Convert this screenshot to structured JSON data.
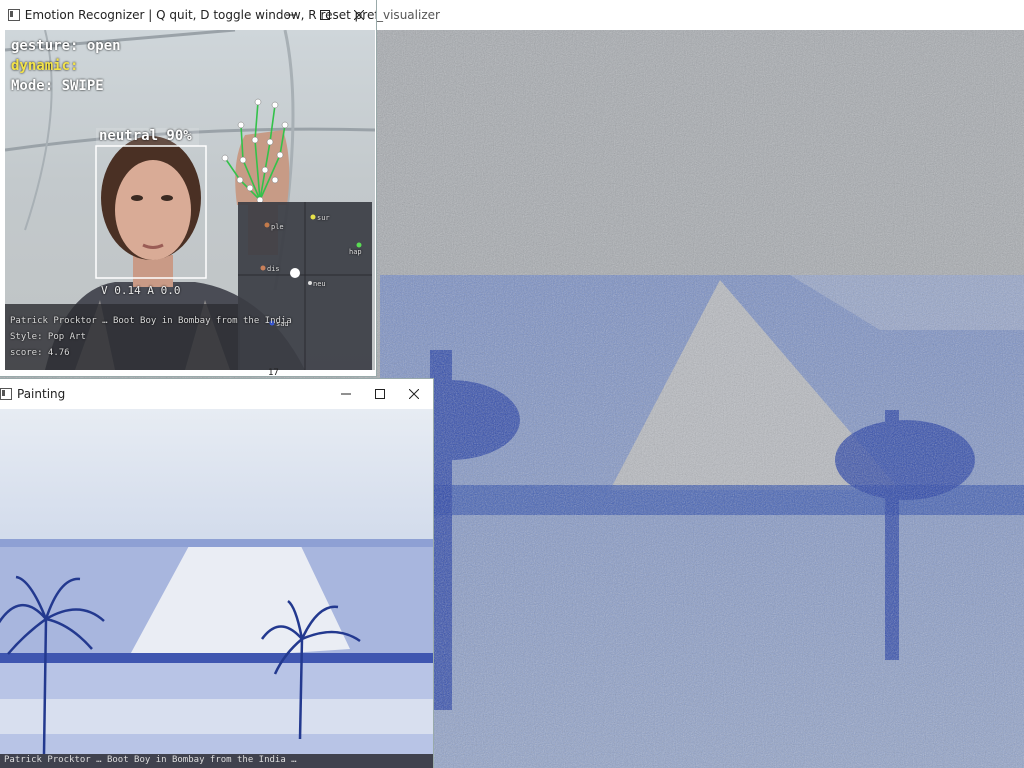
{
  "visualizer_window": {
    "title": "_visualizer"
  },
  "emotion_window": {
    "title": "Emotion Recognizer  |  Q quit, D toggle window, R reset prefs",
    "controls": {
      "minimize": "—",
      "maximize": "☐",
      "close": "✕"
    },
    "overlay": {
      "gesture": "gesture: open",
      "dynamic": "dynamic:",
      "mode": "Mode: SWIPE",
      "face_label": "neutral  90%",
      "va_readout": "V  0.14   A  0.0",
      "painting_line1": "Patrick Procktor … Boot Boy in Bombay from the India",
      "painting_line2": "Style: Pop Art",
      "score": "score: 4.76",
      "bottom_tick": "17"
    },
    "wheel_labels": [
      "sur",
      "ple",
      "hap",
      "dis",
      "neu",
      "sad"
    ],
    "colors": {
      "dynamic_text": "#f2e24a",
      "hand_skeleton": "#33c24a",
      "face_box": "#ffffff"
    }
  },
  "painting_window": {
    "title": "Painting",
    "controls": {
      "minimize": "—",
      "maximize": "☐",
      "close": "✕"
    },
    "caption": "Patrick Procktor … Boot Boy in Bombay from the India … "
  }
}
